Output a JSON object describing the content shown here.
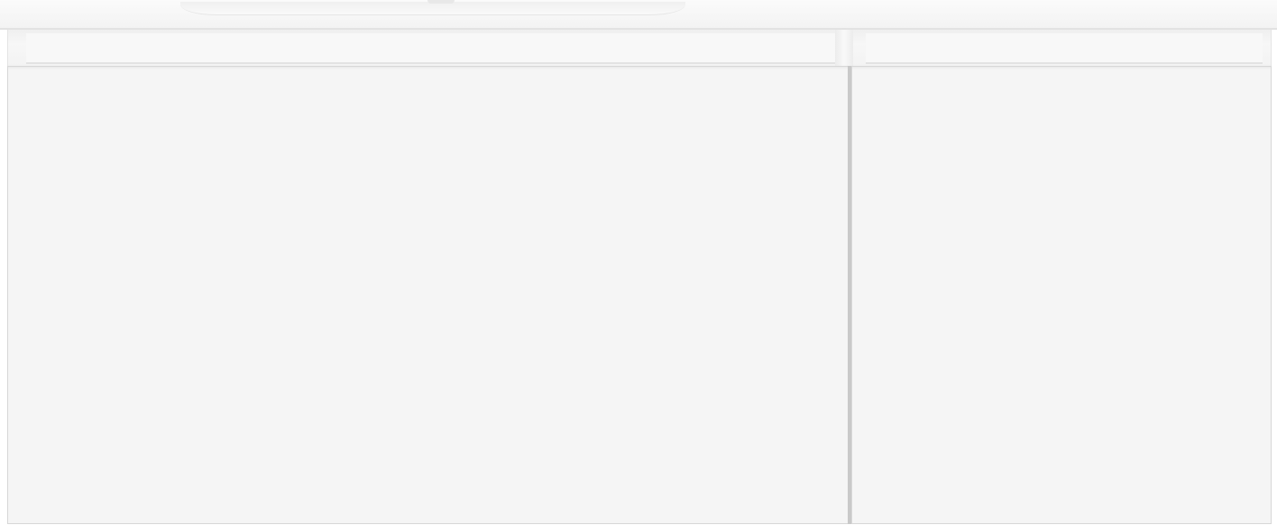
{
  "scene": {
    "subject": "wall-hung-vanity-unit",
    "drawer_count": 2,
    "colors": {
      "background": "#ffffff",
      "cabinet_finish": "#f5f5f5",
      "edge_shadow": "#d7d7d7",
      "drawer_gap": "#c9c9c9"
    }
  }
}
